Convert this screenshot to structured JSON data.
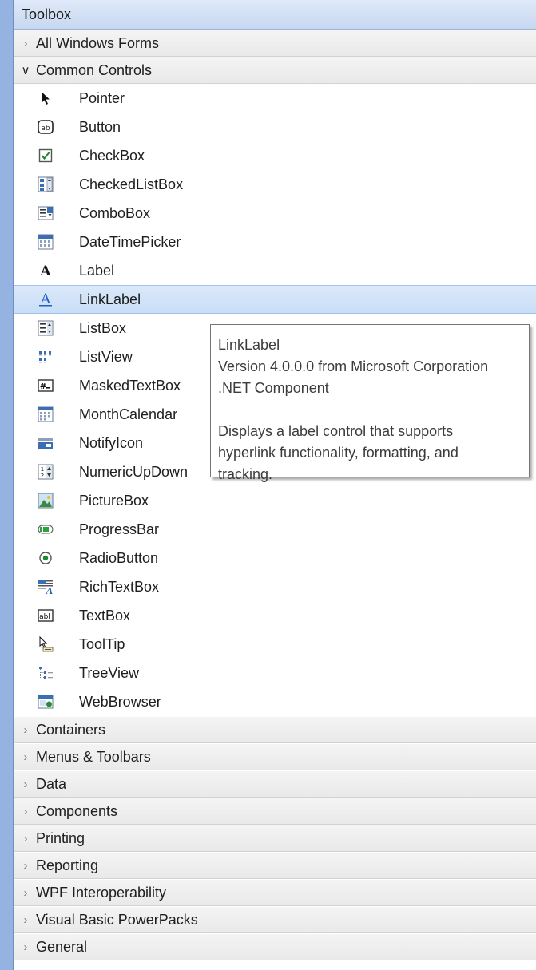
{
  "toolbox": {
    "title": "Toolbox",
    "sections_before": [
      {
        "label": "All Windows Forms",
        "expanded": false
      }
    ],
    "common_controls": {
      "label": "Common Controls",
      "expanded": true,
      "items": [
        {
          "label": "Pointer",
          "icon": "pointer-icon"
        },
        {
          "label": "Button",
          "icon": "button-icon"
        },
        {
          "label": "CheckBox",
          "icon": "checkbox-icon"
        },
        {
          "label": "CheckedListBox",
          "icon": "checkedlistbox-icon"
        },
        {
          "label": "ComboBox",
          "icon": "combobox-icon"
        },
        {
          "label": "DateTimePicker",
          "icon": "datetimepicker-icon"
        },
        {
          "label": "Label",
          "icon": "label-icon"
        },
        {
          "label": "LinkLabel",
          "icon": "linklabel-icon",
          "selected": true
        },
        {
          "label": "ListBox",
          "icon": "listbox-icon"
        },
        {
          "label": "ListView",
          "icon": "listview-icon"
        },
        {
          "label": "MaskedTextBox",
          "icon": "maskedtextbox-icon"
        },
        {
          "label": "MonthCalendar",
          "icon": "monthcalendar-icon"
        },
        {
          "label": "NotifyIcon",
          "icon": "notifyicon-icon"
        },
        {
          "label": "NumericUpDown",
          "icon": "numericupdown-icon"
        },
        {
          "label": "PictureBox",
          "icon": "picturebox-icon"
        },
        {
          "label": "ProgressBar",
          "icon": "progressbar-icon"
        },
        {
          "label": "RadioButton",
          "icon": "radiobutton-icon"
        },
        {
          "label": "RichTextBox",
          "icon": "richtextbox-icon"
        },
        {
          "label": "TextBox",
          "icon": "textbox-icon"
        },
        {
          "label": "ToolTip",
          "icon": "tooltip-icon"
        },
        {
          "label": "TreeView",
          "icon": "treeview-icon"
        },
        {
          "label": "WebBrowser",
          "icon": "webbrowser-icon"
        }
      ]
    },
    "sections_after": [
      {
        "label": "Containers",
        "expanded": false
      },
      {
        "label": "Menus & Toolbars",
        "expanded": false
      },
      {
        "label": "Data",
        "expanded": false
      },
      {
        "label": "Components",
        "expanded": false
      },
      {
        "label": "Printing",
        "expanded": false
      },
      {
        "label": "Reporting",
        "expanded": false
      },
      {
        "label": "WPF Interoperability",
        "expanded": false
      },
      {
        "label": "Visual Basic PowerPacks",
        "expanded": false
      },
      {
        "label": "General",
        "expanded": false
      }
    ]
  },
  "tooltip": {
    "title": "LinkLabel",
    "version": "Version 4.0.0.0 from Microsoft Corporation",
    "component": ".NET Component",
    "description_lines": [
      "Displays a label control that supports",
      "hyperlink functionality, formatting, and",
      "tracking."
    ]
  },
  "colors": {
    "background": "#95b3e0",
    "selected_row": "#c9def6",
    "link_blue": "#1f5fbf"
  }
}
